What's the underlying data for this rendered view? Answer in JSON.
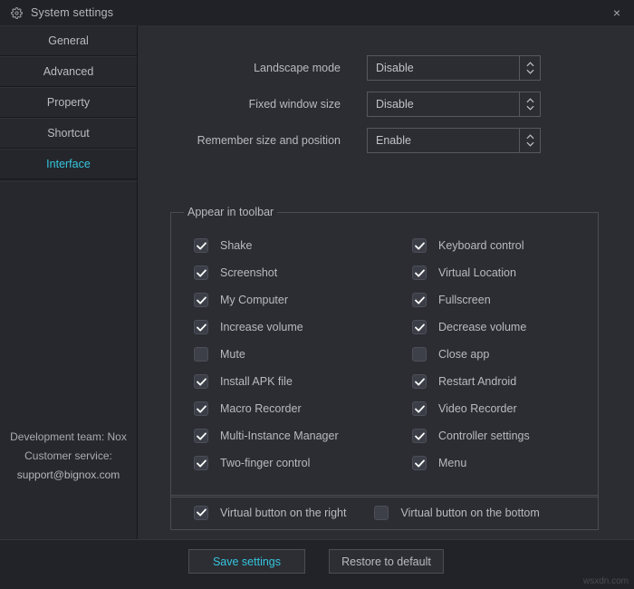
{
  "window": {
    "title": "System settings",
    "gear_icon": "gear-icon",
    "close_label": "×"
  },
  "sidebar": {
    "items": [
      {
        "label": "General",
        "active": false
      },
      {
        "label": "Advanced",
        "active": false
      },
      {
        "label": "Property",
        "active": false
      },
      {
        "label": "Shortcut",
        "active": false
      },
      {
        "label": "Interface",
        "active": true
      }
    ],
    "footer": {
      "line1": "Development team: Nox",
      "line2": "Customer service:",
      "line3": "support@bignox.com"
    }
  },
  "settings_rows": [
    {
      "label": "Landscape mode",
      "value": "Disable"
    },
    {
      "label": "Fixed window size",
      "value": "Disable"
    },
    {
      "label": "Remember size and position",
      "value": "Enable"
    }
  ],
  "toolbar_group": {
    "legend": "Appear in toolbar",
    "checkboxes_left": [
      {
        "label": "Shake",
        "checked": true
      },
      {
        "label": "Screenshot",
        "checked": true
      },
      {
        "label": "My Computer",
        "checked": true
      },
      {
        "label": "Increase volume",
        "checked": true
      },
      {
        "label": "Mute",
        "checked": false
      },
      {
        "label": "Install APK file",
        "checked": true
      },
      {
        "label": "Macro Recorder",
        "checked": true
      },
      {
        "label": "Multi-Instance Manager",
        "checked": true
      },
      {
        "label": "Two-finger control",
        "checked": true
      }
    ],
    "checkboxes_right": [
      {
        "label": "Keyboard control",
        "checked": true
      },
      {
        "label": "Virtual Location",
        "checked": true
      },
      {
        "label": "Fullscreen",
        "checked": true
      },
      {
        "label": "Decrease volume",
        "checked": true
      },
      {
        "label": "Close app",
        "checked": false
      },
      {
        "label": "Restart Android",
        "checked": true
      },
      {
        "label": "Video Recorder",
        "checked": true
      },
      {
        "label": "Controller settings",
        "checked": true
      },
      {
        "label": "Menu",
        "checked": true
      }
    ],
    "virtual_buttons": [
      {
        "label": "Virtual button on the right",
        "checked": true
      },
      {
        "label": "Virtual button on the bottom",
        "checked": false
      }
    ]
  },
  "footer": {
    "save_label": "Save settings",
    "restore_label": "Restore to default"
  },
  "watermark": "wsxdn.com",
  "colors": {
    "accent": "#36c5de",
    "panel_bg": "#2b2d33",
    "sidebar_bg": "#24262b",
    "titlebar_bg": "#212227",
    "text": "#b8bac0",
    "border": "#494c53"
  }
}
